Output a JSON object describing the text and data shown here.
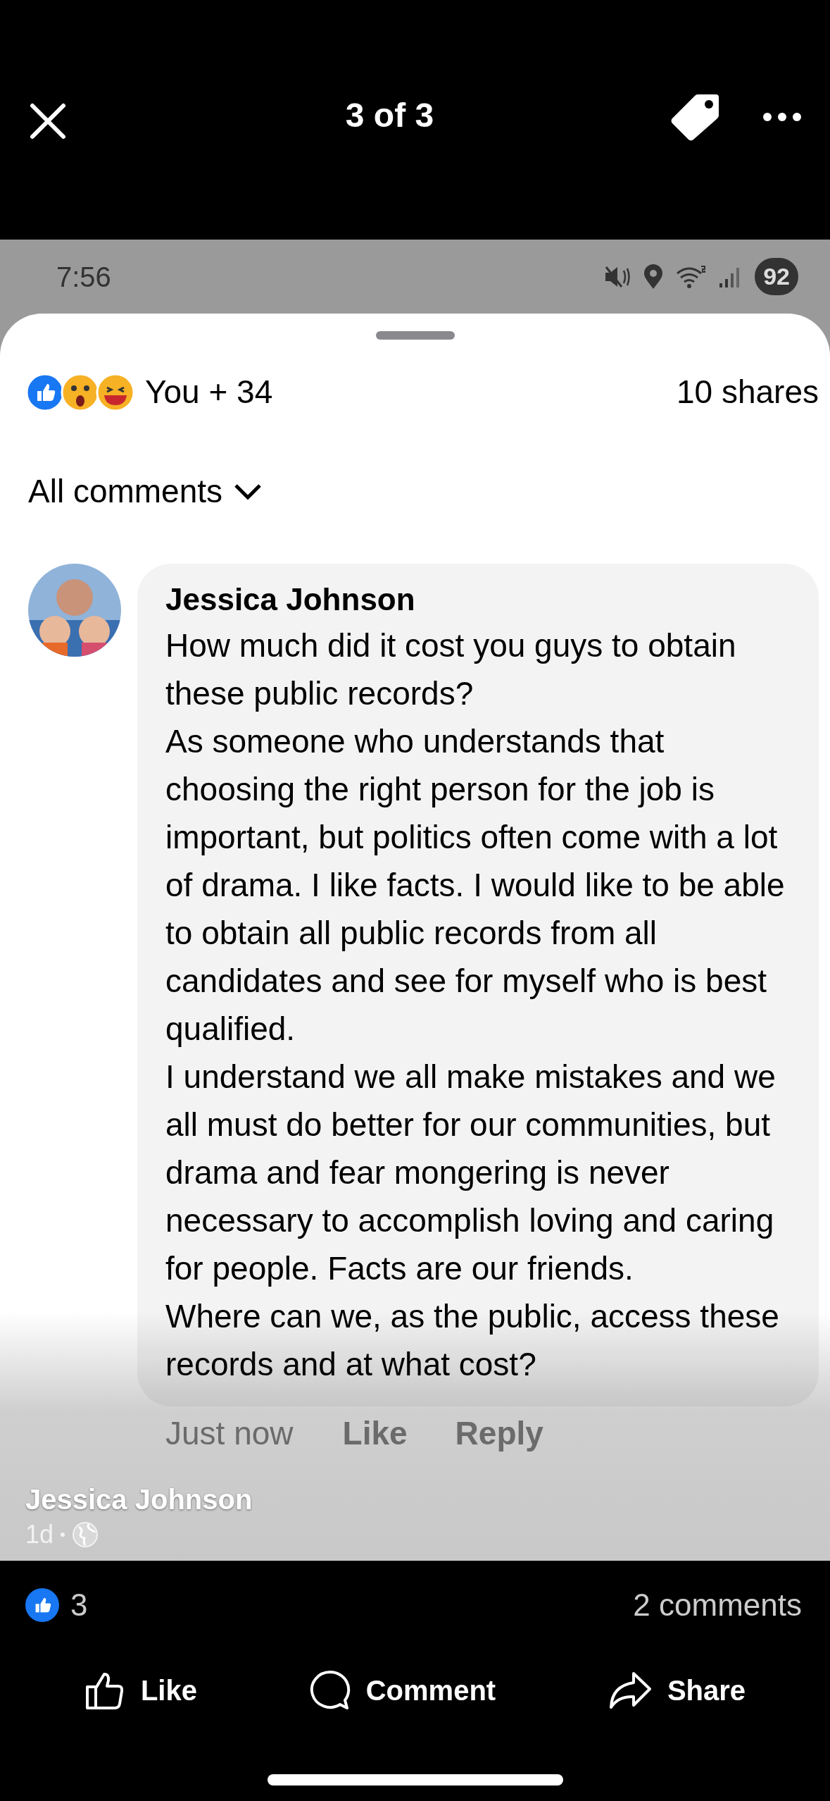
{
  "viewer": {
    "title": "3 of 3"
  },
  "screenshot": {
    "status_bar": {
      "time": "7:56",
      "battery": "92"
    },
    "reactions": {
      "summary": "You + 34",
      "shares": "10 shares"
    },
    "filter": "All comments",
    "comment": {
      "author": "Jessica Johnson",
      "paragraphs": [
        "How much did it cost you guys to obtain these public records?",
        "As someone who understands that choosing the right person for the job is important, but politics often come with a lot of drama. I like facts. I would like to be able to obtain all public records from all candidates and see for myself who is best qualified.",
        "I understand we all make mistakes and we all must do better for our communities, but drama and fear mongering is never necessary to accomplish loving and caring for people. Facts are our friends.",
        "Where can we, as the public, access these records and at what cost?"
      ],
      "time": "Just now",
      "actions": [
        "Like",
        "Reply"
      ]
    }
  },
  "caption": {
    "author": "Jessica Johnson",
    "age": "1d"
  },
  "post_stats": {
    "likes": "3",
    "comments": "2 comments"
  },
  "actions": [
    {
      "kind": "like",
      "label": "Like"
    },
    {
      "kind": "comment",
      "label": "Comment"
    },
    {
      "kind": "share",
      "label": "Share"
    }
  ]
}
